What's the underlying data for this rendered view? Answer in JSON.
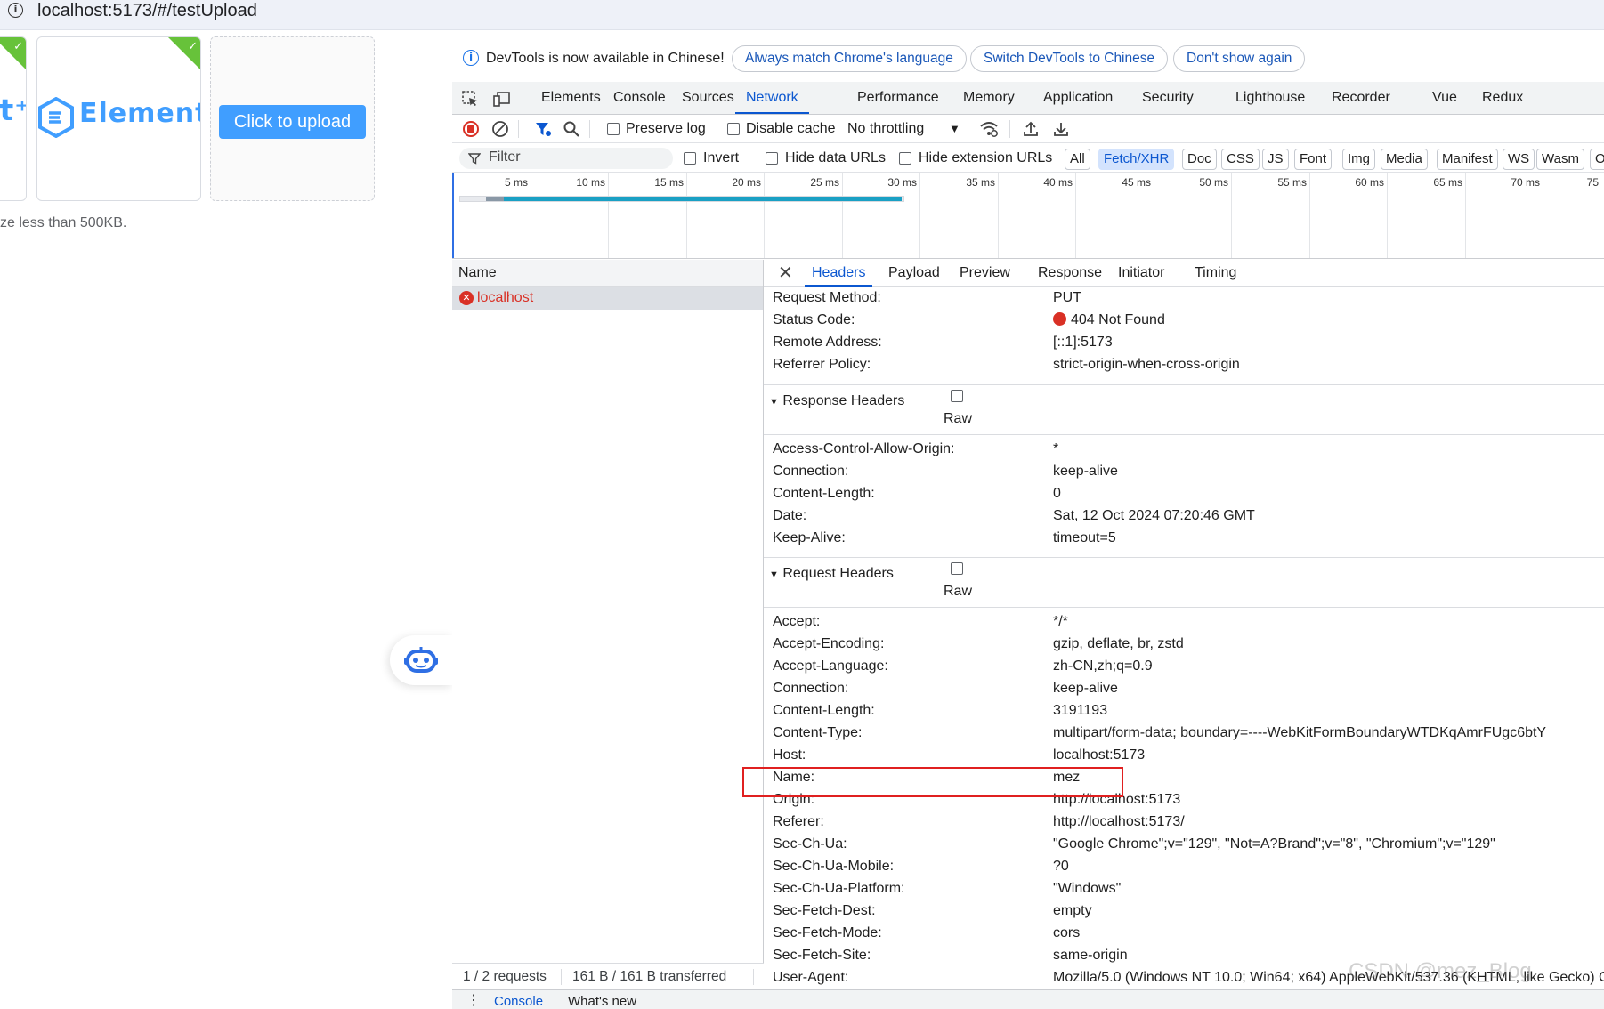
{
  "browser": {
    "url": "localhost:5173/#/testUpload"
  },
  "page": {
    "logo_text_left": "nt⁺",
    "logo_text": "Element⁺",
    "upload_button": "Click to upload",
    "tip": "ze less than 500KB."
  },
  "devtools": {
    "infobar": {
      "message": "DevTools is now available in Chinese!",
      "buttons": [
        "Always match Chrome's language",
        "Switch DevTools to Chinese",
        "Don't show again"
      ]
    },
    "tabs": [
      "Elements",
      "Console",
      "Sources",
      "Network",
      "Performance",
      "Memory",
      "Application",
      "Security",
      "Lighthouse",
      "Recorder",
      "Vue",
      "Redux"
    ],
    "active_tab": "Network",
    "toolbar": {
      "preserve_log": "Preserve log",
      "disable_cache": "Disable cache",
      "throttling": "No throttling"
    },
    "filterbar": {
      "placeholder": "Filter",
      "invert": "Invert",
      "hide_data_urls": "Hide data URLs",
      "hide_extension_urls": "Hide extension URLs",
      "types": [
        "All",
        "Fetch/XHR",
        "Doc",
        "CSS",
        "JS",
        "Font",
        "Img",
        "Media",
        "Manifest",
        "WS",
        "Wasm",
        "O"
      ],
      "selected_type": "Fetch/XHR"
    },
    "timeline": {
      "ticks": [
        "5 ms",
        "10 ms",
        "15 ms",
        "20 ms",
        "25 ms",
        "30 ms",
        "35 ms",
        "40 ms",
        "45 ms",
        "50 ms",
        "55 ms",
        "60 ms",
        "65 ms",
        "70 ms",
        "75"
      ]
    },
    "request_list": {
      "header": "Name",
      "rows": [
        "localhost"
      ],
      "status_requests": "1 / 2 requests",
      "status_transferred": "161 B / 161 B transferred"
    },
    "detail_tabs": [
      "Headers",
      "Payload",
      "Preview",
      "Response",
      "Initiator",
      "Timing"
    ],
    "general": [
      {
        "k": "Request Method:",
        "v": "PUT"
      },
      {
        "k": "Status Code:",
        "v": "404 Not Found"
      },
      {
        "k": "Remote Address:",
        "v": "[::1]:5173"
      },
      {
        "k": "Referrer Policy:",
        "v": "strict-origin-when-cross-origin"
      }
    ],
    "response_headers_title": "Response Headers",
    "raw_label": "Raw",
    "response_headers": [
      {
        "k": "Access-Control-Allow-Origin:",
        "v": "*"
      },
      {
        "k": "Connection:",
        "v": "keep-alive"
      },
      {
        "k": "Content-Length:",
        "v": "0"
      },
      {
        "k": "Date:",
        "v": "Sat, 12 Oct 2024 07:20:46 GMT"
      },
      {
        "k": "Keep-Alive:",
        "v": "timeout=5"
      }
    ],
    "request_headers_title": "Request Headers",
    "request_headers": [
      {
        "k": "Accept:",
        "v": "*/*"
      },
      {
        "k": "Accept-Encoding:",
        "v": "gzip, deflate, br, zstd"
      },
      {
        "k": "Accept-Language:",
        "v": "zh-CN,zh;q=0.9"
      },
      {
        "k": "Connection:",
        "v": "keep-alive"
      },
      {
        "k": "Content-Length:",
        "v": "3191193"
      },
      {
        "k": "Content-Type:",
        "v": "multipart/form-data; boundary=----WebKitFormBoundaryWTDKqAmrFUgc6btY"
      },
      {
        "k": "Host:",
        "v": "localhost:5173"
      },
      {
        "k": "Name:",
        "v": "mez"
      },
      {
        "k": "Origin:",
        "v": "http://localhost:5173"
      },
      {
        "k": "Referer:",
        "v": "http://localhost:5173/"
      },
      {
        "k": "Sec-Ch-Ua:",
        "v": "\"Google Chrome\";v=\"129\", \"Not=A?Brand\";v=\"8\", \"Chromium\";v=\"129\""
      },
      {
        "k": "Sec-Ch-Ua-Mobile:",
        "v": "?0"
      },
      {
        "k": "Sec-Ch-Ua-Platform:",
        "v": "\"Windows\""
      },
      {
        "k": "Sec-Fetch-Dest:",
        "v": "empty"
      },
      {
        "k": "Sec-Fetch-Mode:",
        "v": "cors"
      },
      {
        "k": "Sec-Fetch-Site:",
        "v": "same-origin"
      },
      {
        "k": "User-Agent:",
        "v": "Mozilla/5.0 (Windows NT 10.0; Win64; x64) AppleWebKit/537.36 (KHTML, like Gecko) C"
      }
    ],
    "drawer": {
      "console": "Console",
      "whats_new": "What's new"
    },
    "watermark": "CSDN @mez_Blog"
  },
  "colors": {
    "accent": "#0b57d0",
    "element_blue": "#409eff",
    "success": "#67c23a",
    "error": "#d93025",
    "highlight": "#e02020"
  }
}
